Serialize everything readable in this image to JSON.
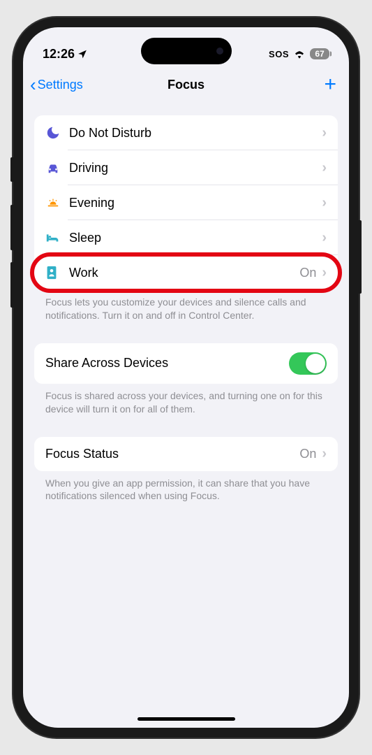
{
  "status": {
    "time": "12:26",
    "sos": "SOS",
    "battery": "67"
  },
  "nav": {
    "back": "Settings",
    "title": "Focus"
  },
  "focus_modes": [
    {
      "label": "Do Not Disturb",
      "icon": "moon",
      "color": "#5856d6",
      "status": ""
    },
    {
      "label": "Driving",
      "icon": "car",
      "color": "#5856d6",
      "status": ""
    },
    {
      "label": "Evening",
      "icon": "sunset",
      "color": "#ff9500",
      "status": ""
    },
    {
      "label": "Sleep",
      "icon": "bed",
      "color": "#30b0c7",
      "status": ""
    },
    {
      "label": "Work",
      "icon": "badge",
      "color": "#30b0c7",
      "status": "On"
    }
  ],
  "footers": {
    "modes": "Focus lets you customize your devices and silence calls and notifications. Turn it on and off in Control Center.",
    "share": "Focus is shared across your devices, and turning one on for this device will turn it on for all of them.",
    "status": "When you give an app permission, it can share that you have notifications silenced when using Focus."
  },
  "share": {
    "label": "Share Across Devices"
  },
  "focus_status": {
    "label": "Focus Status",
    "value": "On"
  }
}
